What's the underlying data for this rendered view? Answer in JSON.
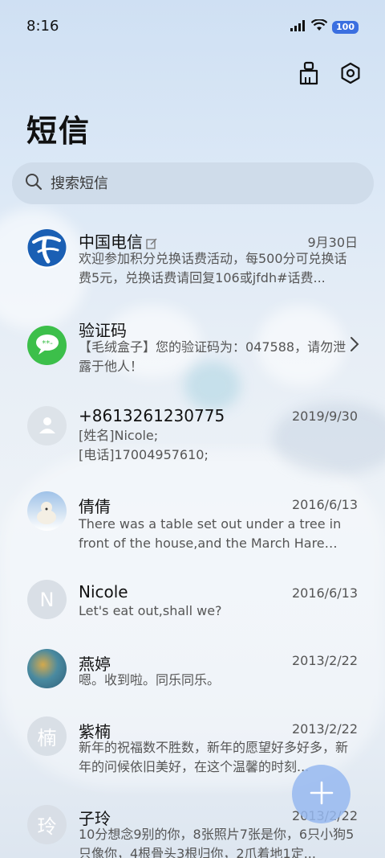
{
  "status": {
    "time": "8:16",
    "battery": "100"
  },
  "header": {
    "title": "短信"
  },
  "search": {
    "placeholder": "搜索短信"
  },
  "messages": [
    {
      "name": "中国电信",
      "date": "9月30日",
      "preview": "欢迎参加积分兑换话费活动，每500分可兑换话费5元，兑换话费请回复106或jfdh#话费...",
      "avatar_letter": ""
    },
    {
      "name": "验证码",
      "date": "",
      "preview": "【毛绒盒子】您的验证码为：047588，请勿泄露于他人！",
      "avatar_letter": ""
    },
    {
      "name": "+8613261230775",
      "date": "2019/9/30",
      "preview": "[姓名]Nicole;\n[电话]17004957610;",
      "avatar_letter": ""
    },
    {
      "name": "倩倩",
      "date": "2016/6/13",
      "preview": "There was a table set out under a tree in front of the house,and the March Hare an...",
      "avatar_letter": ""
    },
    {
      "name": "Nicole",
      "date": "2016/6/13",
      "preview": "Let's eat out,shall we?",
      "avatar_letter": "N"
    },
    {
      "name": "燕婷",
      "date": "2013/2/22",
      "preview": "嗯。收到啦。同乐同乐。",
      "avatar_letter": ""
    },
    {
      "name": "紫楠",
      "date": "2013/2/22",
      "preview": "新年的祝福数不胜数，新年的愿望好多好多，新年的问候依旧美好，在这个温馨的时刻...",
      "avatar_letter": "楠"
    },
    {
      "name": "子玲",
      "date": "2013/2/22",
      "preview": "10分想念9别的你，8张照片7张是你，6只小狗5只像你，4根骨头3根归你，2爪着地1定...",
      "avatar_letter": "玲"
    }
  ],
  "colors": {
    "accent": "#3b6fe0",
    "fab": "#96b9f0"
  }
}
